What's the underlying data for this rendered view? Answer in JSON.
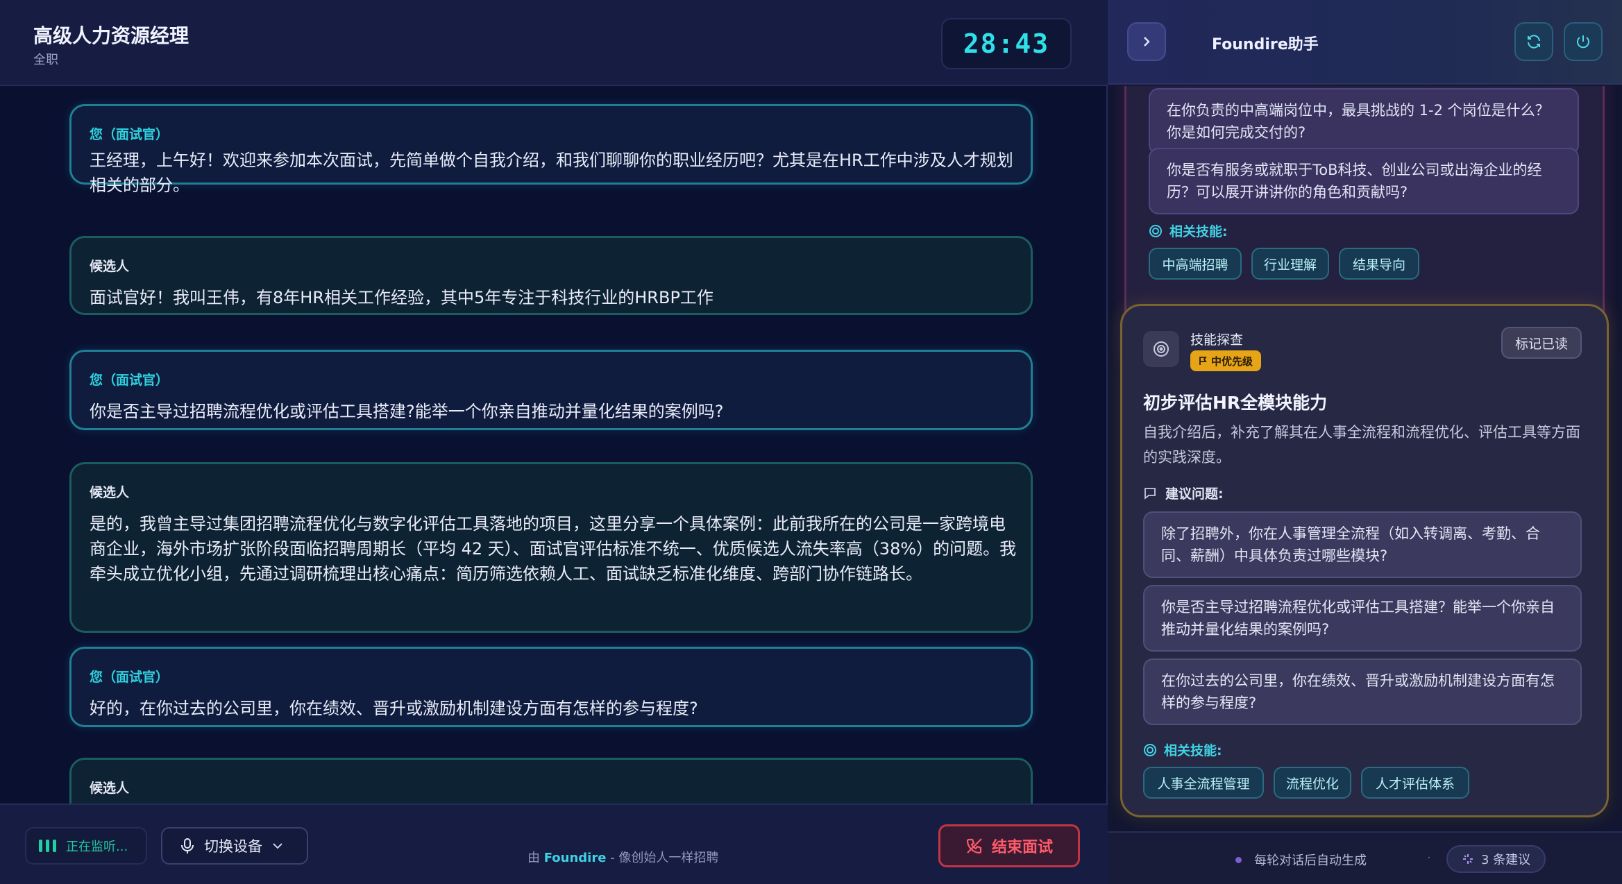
{
  "header": {
    "job_title": "高级人力资源经理",
    "job_type": "全职",
    "timer": "28:43"
  },
  "transcript": [
    {
      "role": "interviewer",
      "speaker": "您（面试官）",
      "text": "王经理，上午好！欢迎来参加本次面试，先简单做个自我介绍，和我们聊聊你的职业经历吧？尤其是在HR工作中涉及人才规划相关的部分。"
    },
    {
      "role": "candidate",
      "speaker": "候选人",
      "text": "面试官好！我叫王伟，有8年HR相关工作经验，其中5年专注于科技行业的HRBP工作"
    },
    {
      "role": "interviewer",
      "speaker": "您（面试官）",
      "text": "你是否主导过招聘流程优化或评估工具搭建?能举一个你亲自推动并量化结果的案例吗?"
    },
    {
      "role": "candidate",
      "speaker": "候选人",
      "text": "是的，我曾主导过集团招聘流程优化与数字化评估工具落地的项目，这里分享一个具体案例：此前我所在的公司是一家跨境电商企业，海外市场扩张阶段面临招聘周期长（平均 42 天）、面试官评估标准不统一、优质候选人流失率高（38%）的问题。我牵头成立优化小组，先通过调研梳理出核心痛点：简历筛选依赖人工、面试缺乏标准化维度、跨部门协作链路长。"
    },
    {
      "role": "interviewer",
      "speaker": "您（面试官）",
      "text": "好的，在你过去的公司里，你在绩效、晋升或激励机制建设方面有怎样的参与程度?"
    },
    {
      "role": "candidate",
      "speaker": "候选人",
      "text": ""
    }
  ],
  "footer": {
    "listening": "正在监听...",
    "switch_device": "切换设备",
    "brand_prefix": "由",
    "brand_name": "Foundire",
    "brand_suffix": "- 像创始人一样招聘",
    "end_interview": "结束面试"
  },
  "assistant": {
    "title": "Foundire助手",
    "card1": {
      "questions": [
        "在你负责的中高端岗位中，最具挑战的 1-2 个岗位是什么？你是如何完成交付的?",
        "你是否有服务或就职于ToB科技、创业公司或出海企业的经历？可以展开讲讲你的角色和贡献吗?"
      ],
      "skills_label": "相关技能:",
      "skills": [
        "中高端招聘",
        "行业理解",
        "结果导向"
      ]
    },
    "card2": {
      "category": "技能探查",
      "priority": "中优先级",
      "mark_read": "标记已读",
      "title": "初步评估HR全模块能力",
      "description": "自我介绍后，补充了解其在人事全流程和流程优化、评估工具等方面的实践深度。",
      "suggestions_label": "建议问题:",
      "questions": [
        "除了招聘外，你在人事管理全流程（如入转调离、考勤、合同、薪酬）中具体负责过哪些模块?",
        "你是否主导过招聘流程优化或评估工具搭建？能举一个你亲自推动并量化结果的案例吗?",
        "在你过去的公司里，你在绩效、晋升或激励机制建设方面有怎样的参与程度?"
      ],
      "skills_label": "相关技能:",
      "skills": [
        "人事全流程管理",
        "流程优化",
        "人才评估体系"
      ]
    },
    "footer": {
      "auto_generate": "每轮对话后自动生成",
      "separator": "·",
      "suggestion_count": "3 条建议"
    }
  },
  "colors": {
    "accent_cyan": "#2fe0ea",
    "danger": "#ff5b6a",
    "priority": "#e6a417",
    "listening_green": "#1fd0a0"
  }
}
